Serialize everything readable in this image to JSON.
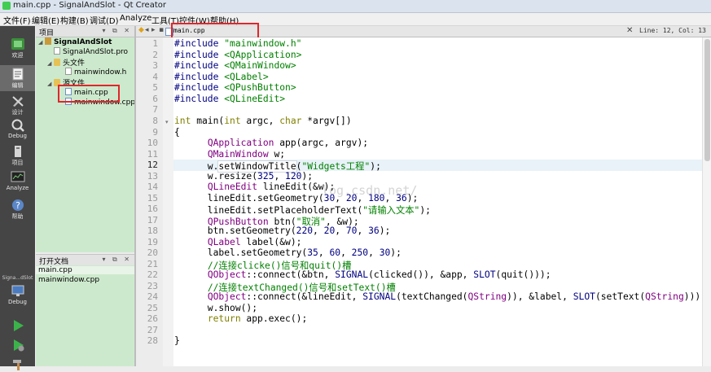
{
  "window": {
    "title": "main.cpp - SignalAndSlot - Qt Creator"
  },
  "menu": [
    "文件(F)",
    "编辑(E)",
    "构建(B)",
    "调试(D)",
    "Analyze",
    "工具(T)",
    "控件(W)",
    "帮助(H)"
  ],
  "modes": [
    {
      "label": "欢迎",
      "icon": "welcome-icon"
    },
    {
      "label": "编辑",
      "icon": "edit-icon"
    },
    {
      "label": "设计",
      "icon": "design-icon"
    },
    {
      "label": "Debug",
      "icon": "debug-icon"
    },
    {
      "label": "项目",
      "icon": "projects-icon"
    },
    {
      "label": "Analyze",
      "icon": "analyze-icon"
    },
    {
      "label": "帮助",
      "icon": "help-icon"
    }
  ],
  "kit": {
    "project": "Signa...dSlot",
    "config": "Debug"
  },
  "project_pane": {
    "header": "项目",
    "items": [
      {
        "label": "SignalAndSlot",
        "kind": "project"
      },
      {
        "label": "SignalAndSlot.pro",
        "kind": "pro"
      },
      {
        "label": "头文件",
        "kind": "folder"
      },
      {
        "label": "mainwindow.h",
        "kind": "header"
      },
      {
        "label": "源文件",
        "kind": "folder"
      },
      {
        "label": "main.cpp",
        "kind": "source"
      },
      {
        "label": "mainwindow.cpp",
        "kind": "source"
      }
    ]
  },
  "open_docs": {
    "header": "打开文档",
    "items": [
      "main.cpp",
      "mainwindow.cpp"
    ]
  },
  "editor": {
    "tab": "main.cpp",
    "position": "Line: 12, Col: 13",
    "current_line": 12,
    "line_numbers": [
      "1",
      "2",
      "3",
      "4",
      "5",
      "6",
      "7",
      "8",
      "9",
      "10",
      "11",
      "12",
      "13",
      "14",
      "15",
      "16",
      "17",
      "18",
      "19",
      "20",
      "21",
      "22",
      "23",
      "24",
      "25",
      "26",
      "27",
      "28"
    ],
    "watermark": "log.csdn.net/"
  },
  "colors": {
    "highlight": "#e0262b",
    "tree_bg": "#cde9cd",
    "modebar": "#454545"
  }
}
